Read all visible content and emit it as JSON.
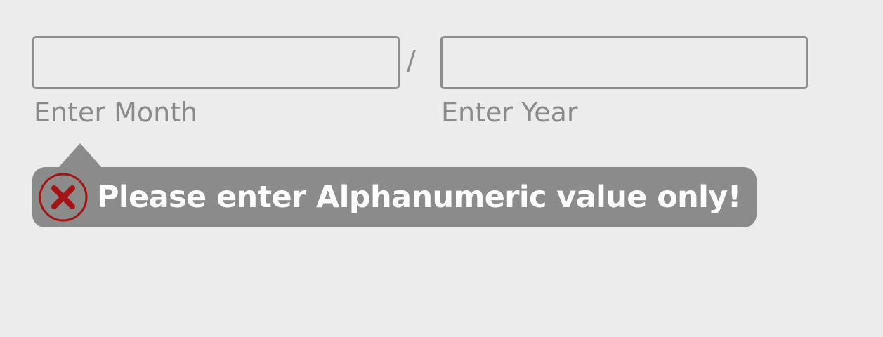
{
  "form": {
    "month": {
      "value": "",
      "placeholder": "",
      "label": "Enter Month"
    },
    "separator": "/",
    "year": {
      "value": "",
      "placeholder": "",
      "label": "Enter Year"
    }
  },
  "validation": {
    "message": "Please enter Alphanumeric value only!",
    "icon": "error-x-circle-icon",
    "colors": {
      "tooltip_background": "#8b8b8b",
      "icon_red": "#a31515",
      "text": "#ffffff"
    }
  }
}
